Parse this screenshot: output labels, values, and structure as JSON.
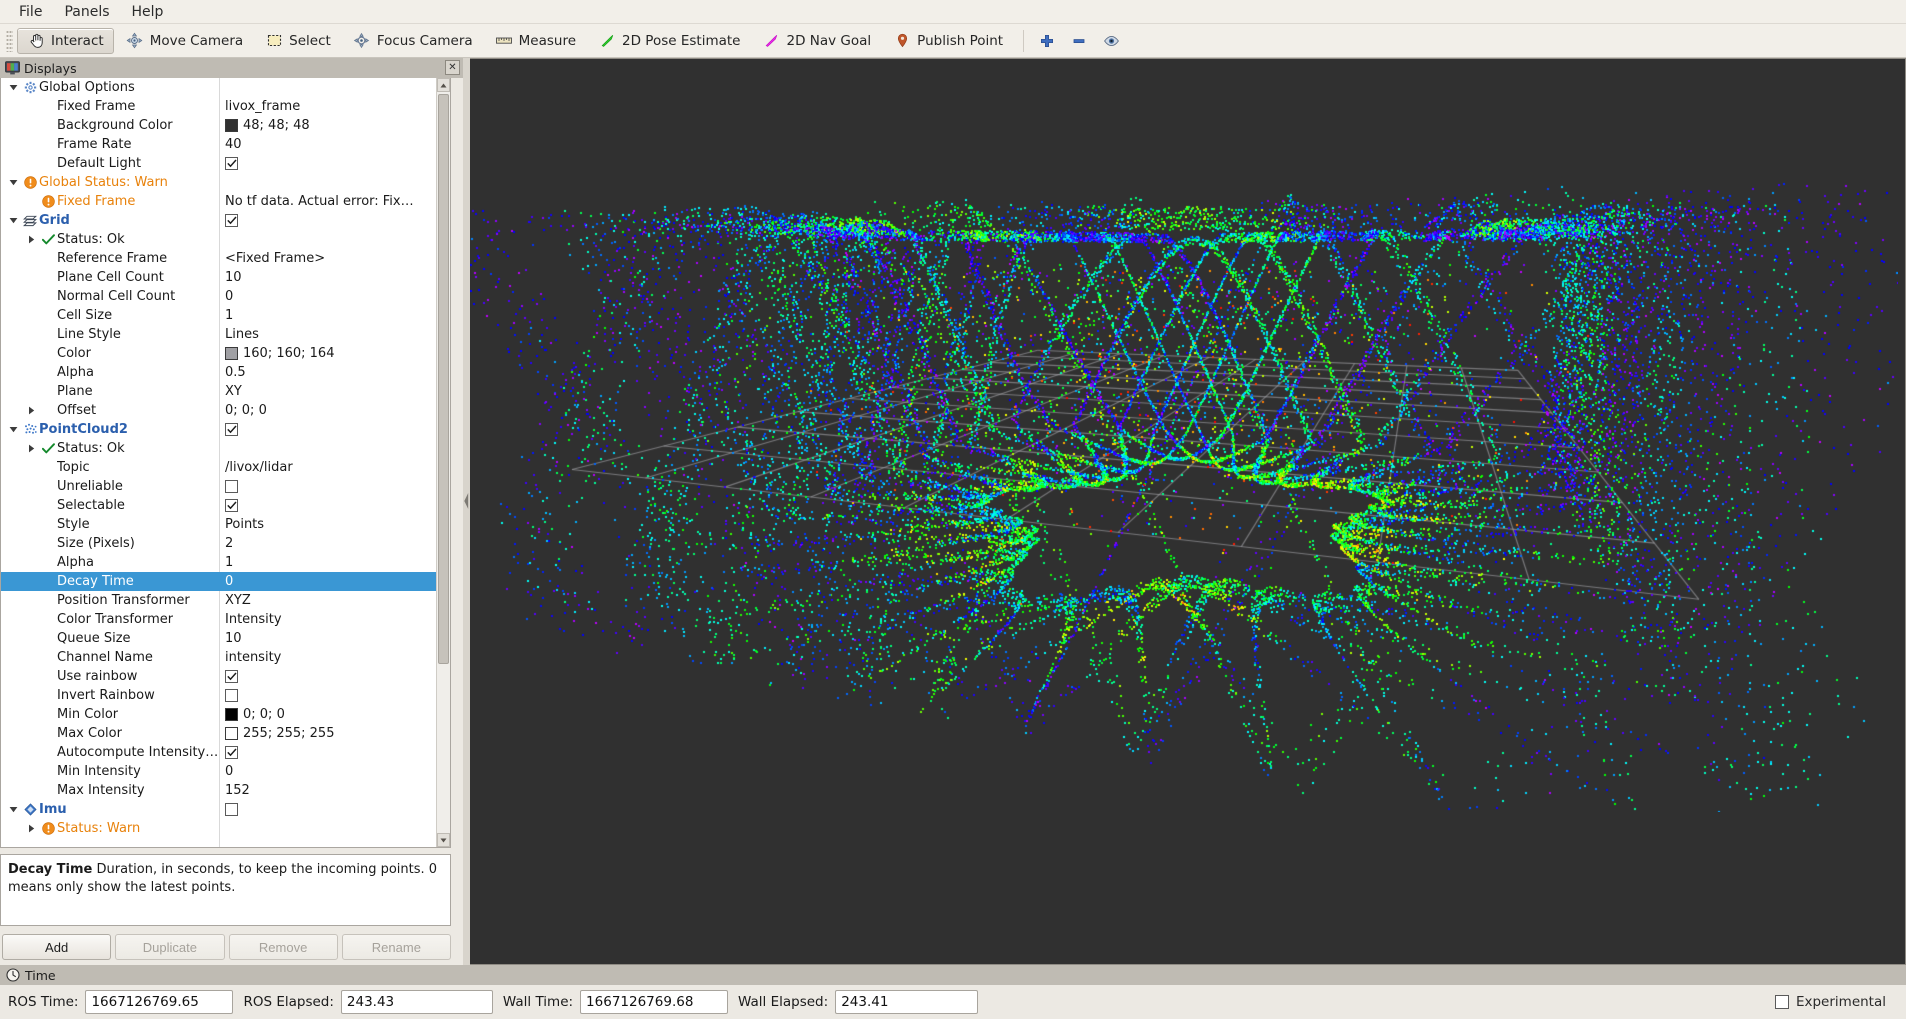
{
  "menubar": {
    "items": [
      "File",
      "Panels",
      "Help"
    ]
  },
  "toolbar": {
    "items": [
      {
        "label": "Interact",
        "icon": "hand-cursor-icon",
        "checked": true
      },
      {
        "label": "Move Camera",
        "icon": "move-camera-icon",
        "checked": false
      },
      {
        "label": "Select",
        "icon": "selection-box-icon",
        "checked": false
      },
      {
        "label": "Focus Camera",
        "icon": "focus-camera-icon",
        "checked": false
      },
      {
        "label": "Measure",
        "icon": "ruler-icon",
        "checked": false
      },
      {
        "label": "2D Pose Estimate",
        "icon": "green-arrow-icon",
        "checked": false
      },
      {
        "label": "2D Nav Goal",
        "icon": "magenta-arrow-icon",
        "checked": false
      },
      {
        "label": "Publish Point",
        "icon": "map-pin-icon",
        "checked": false
      }
    ],
    "small_buttons": [
      {
        "icon": "plus-icon",
        "label": ""
      },
      {
        "icon": "minus-icon",
        "label": ""
      },
      {
        "icon": "eye-icon",
        "label": ""
      }
    ]
  },
  "displays_panel": {
    "title": "Displays",
    "title_icon": "display-monitor-icon",
    "close_label": "✕",
    "rows": [
      {
        "indent": 0,
        "arrow": "down",
        "icon": "gear-icon",
        "label": "Global Options",
        "style": "plain",
        "value": "",
        "value_type": "none"
      },
      {
        "indent": 1,
        "arrow": "none",
        "icon": "none",
        "label": "Fixed Frame",
        "style": "plain",
        "value": "livox_frame",
        "value_type": "text"
      },
      {
        "indent": 1,
        "arrow": "none",
        "icon": "none",
        "label": "Background Color",
        "style": "plain",
        "value": "48; 48; 48",
        "value_type": "color",
        "swatch": "#303030"
      },
      {
        "indent": 1,
        "arrow": "none",
        "icon": "none",
        "label": "Frame Rate",
        "style": "plain",
        "value": "40",
        "value_type": "text"
      },
      {
        "indent": 1,
        "arrow": "none",
        "icon": "none",
        "label": "Default Light",
        "style": "plain",
        "value": "checked",
        "value_type": "check"
      },
      {
        "indent": 0,
        "arrow": "down",
        "icon": "warn-icon",
        "label": "Global Status: Warn",
        "style": "orange",
        "value": "",
        "value_type": "none"
      },
      {
        "indent": 1,
        "arrow": "none",
        "icon": "warn-icon",
        "label": "Fixed Frame",
        "style": "orange",
        "value": "No tf data.  Actual error: Fix…",
        "value_type": "text"
      },
      {
        "indent": 0,
        "arrow": "down",
        "icon": "grid-icon",
        "label": "Grid",
        "style": "blue",
        "value": "checked",
        "value_type": "check"
      },
      {
        "indent": 1,
        "arrow": "right",
        "icon": "ok-icon",
        "label": "Status: Ok",
        "style": "plain",
        "value": "",
        "value_type": "none"
      },
      {
        "indent": 1,
        "arrow": "none",
        "icon": "none",
        "label": "Reference Frame",
        "style": "plain",
        "value": "<Fixed Frame>",
        "value_type": "text"
      },
      {
        "indent": 1,
        "arrow": "none",
        "icon": "none",
        "label": "Plane Cell Count",
        "style": "plain",
        "value": "10",
        "value_type": "text"
      },
      {
        "indent": 1,
        "arrow": "none",
        "icon": "none",
        "label": "Normal Cell Count",
        "style": "plain",
        "value": "0",
        "value_type": "text"
      },
      {
        "indent": 1,
        "arrow": "none",
        "icon": "none",
        "label": "Cell Size",
        "style": "plain",
        "value": "1",
        "value_type": "text"
      },
      {
        "indent": 1,
        "arrow": "none",
        "icon": "none",
        "label": "Line Style",
        "style": "plain",
        "value": "Lines",
        "value_type": "text"
      },
      {
        "indent": 1,
        "arrow": "none",
        "icon": "none",
        "label": "Color",
        "style": "plain",
        "value": "160; 160; 164",
        "value_type": "color",
        "swatch": "#a0a0a4"
      },
      {
        "indent": 1,
        "arrow": "none",
        "icon": "none",
        "label": "Alpha",
        "style": "plain",
        "value": "0.5",
        "value_type": "text"
      },
      {
        "indent": 1,
        "arrow": "none",
        "icon": "none",
        "label": "Plane",
        "style": "plain",
        "value": "XY",
        "value_type": "text"
      },
      {
        "indent": 1,
        "arrow": "right",
        "icon": "none",
        "label": "Offset",
        "style": "plain",
        "value": "0; 0; 0",
        "value_type": "text"
      },
      {
        "indent": 0,
        "arrow": "down",
        "icon": "pointcloud-icon",
        "label": "PointCloud2",
        "style": "blue",
        "value": "checked",
        "value_type": "check"
      },
      {
        "indent": 1,
        "arrow": "right",
        "icon": "ok-icon",
        "label": "Status: Ok",
        "style": "plain",
        "value": "",
        "value_type": "none"
      },
      {
        "indent": 1,
        "arrow": "none",
        "icon": "none",
        "label": "Topic",
        "style": "plain",
        "value": "/livox/lidar",
        "value_type": "text"
      },
      {
        "indent": 1,
        "arrow": "none",
        "icon": "none",
        "label": "Unreliable",
        "style": "plain",
        "value": "unchecked",
        "value_type": "check"
      },
      {
        "indent": 1,
        "arrow": "none",
        "icon": "none",
        "label": "Selectable",
        "style": "plain",
        "value": "checked",
        "value_type": "check"
      },
      {
        "indent": 1,
        "arrow": "none",
        "icon": "none",
        "label": "Style",
        "style": "plain",
        "value": "Points",
        "value_type": "text"
      },
      {
        "indent": 1,
        "arrow": "none",
        "icon": "none",
        "label": "Size (Pixels)",
        "style": "plain",
        "value": "2",
        "value_type": "text"
      },
      {
        "indent": 1,
        "arrow": "none",
        "icon": "none",
        "label": "Alpha",
        "style": "plain",
        "value": "1",
        "value_type": "text"
      },
      {
        "indent": 1,
        "arrow": "none",
        "icon": "none",
        "label": "Decay Time",
        "style": "plain",
        "value": "0",
        "value_type": "text",
        "selected": true
      },
      {
        "indent": 1,
        "arrow": "none",
        "icon": "none",
        "label": "Position Transformer",
        "style": "plain",
        "value": "XYZ",
        "value_type": "text"
      },
      {
        "indent": 1,
        "arrow": "none",
        "icon": "none",
        "label": "Color Transformer",
        "style": "plain",
        "value": "Intensity",
        "value_type": "text"
      },
      {
        "indent": 1,
        "arrow": "none",
        "icon": "none",
        "label": "Queue Size",
        "style": "plain",
        "value": "10",
        "value_type": "text"
      },
      {
        "indent": 1,
        "arrow": "none",
        "icon": "none",
        "label": "Channel Name",
        "style": "plain",
        "value": "intensity",
        "value_type": "text"
      },
      {
        "indent": 1,
        "arrow": "none",
        "icon": "none",
        "label": "Use rainbow",
        "style": "plain",
        "value": "checked",
        "value_type": "check"
      },
      {
        "indent": 1,
        "arrow": "none",
        "icon": "none",
        "label": "Invert Rainbow",
        "style": "plain",
        "value": "unchecked",
        "value_type": "check"
      },
      {
        "indent": 1,
        "arrow": "none",
        "icon": "none",
        "label": "Min Color",
        "style": "plain",
        "value": "0; 0; 0",
        "value_type": "color",
        "swatch": "#000000"
      },
      {
        "indent": 1,
        "arrow": "none",
        "icon": "none",
        "label": "Max Color",
        "style": "plain",
        "value": "255; 255; 255",
        "value_type": "color",
        "swatch": "#ffffff"
      },
      {
        "indent": 1,
        "arrow": "none",
        "icon": "none",
        "label": "Autocompute Intensity …",
        "style": "plain",
        "value": "checked",
        "value_type": "check"
      },
      {
        "indent": 1,
        "arrow": "none",
        "icon": "none",
        "label": "Min Intensity",
        "style": "plain",
        "value": "0",
        "value_type": "text"
      },
      {
        "indent": 1,
        "arrow": "none",
        "icon": "none",
        "label": "Max Intensity",
        "style": "plain",
        "value": "152",
        "value_type": "text"
      },
      {
        "indent": 0,
        "arrow": "down",
        "icon": "imu-icon",
        "label": "Imu",
        "style": "blue",
        "value": "unchecked",
        "value_type": "check"
      },
      {
        "indent": 1,
        "arrow": "right",
        "icon": "warn-icon",
        "label": "Status: Warn",
        "style": "orange",
        "value": "",
        "value_type": "none"
      }
    ]
  },
  "description": {
    "title": "Decay Time",
    "text": "Duration, in seconds, to keep the incoming points. 0 means only show the latest points."
  },
  "buttons": [
    {
      "label": "Add",
      "enabled": true
    },
    {
      "label": "Duplicate",
      "enabled": false
    },
    {
      "label": "Remove",
      "enabled": false
    },
    {
      "label": "Rename",
      "enabled": false
    }
  ],
  "time_panel": {
    "title": "Time",
    "title_icon": "clock-icon",
    "fields": [
      {
        "label": "ROS Time:",
        "value": "1667126769.65",
        "width_class": "w-ros"
      },
      {
        "label": "ROS Elapsed:",
        "value": "243.43",
        "width_class": "w-el"
      },
      {
        "label": "Wall Time:",
        "value": "1667126769.68",
        "width_class": "w-wall"
      },
      {
        "label": "Wall Elapsed:",
        "value": "243.41",
        "width_class": "w-wel"
      }
    ],
    "experimental": {
      "label": "Experimental",
      "checked": false
    }
  },
  "view3d": {
    "background_color": "#303030",
    "grid_color": "#a0a0a4",
    "grid_cells": 10,
    "point_size": 2,
    "color_map": "rainbow-intensity",
    "topic": "/livox/lidar"
  }
}
